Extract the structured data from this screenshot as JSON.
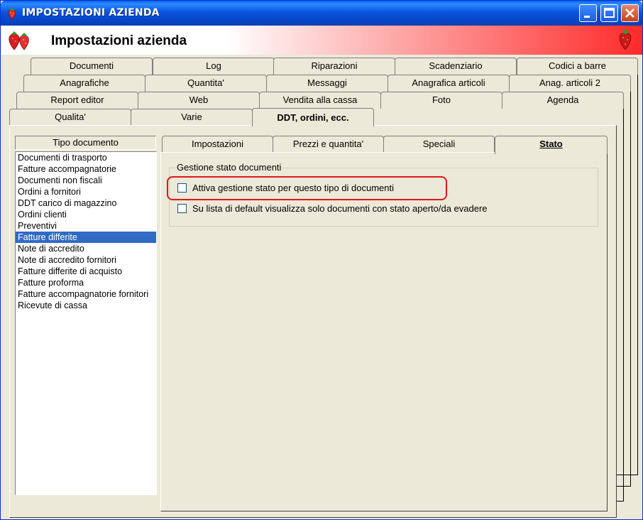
{
  "window": {
    "title": "IMPOSTAZIONI AZIENDA",
    "header_title": "Impostazioni azienda"
  },
  "tabs": {
    "row1": [
      "Documenti",
      "Log",
      "Riparazioni",
      "Scadenziario",
      "Codici a barre"
    ],
    "row2": [
      "Anagrafiche",
      "Quantita'",
      "Messaggi",
      "Anagrafica articoli",
      "Anag. articoli 2"
    ],
    "row3": [
      "Report editor",
      "Web",
      "Vendita alla cassa",
      "Foto",
      "Agenda"
    ],
    "row4": [
      "Qualita'",
      "Varie",
      "DDT, ordini, ecc."
    ],
    "active": "DDT, ordini, ecc."
  },
  "doc_types": {
    "header": "Tipo documento",
    "items": [
      "Documenti di trasporto",
      "Fatture accompagnatorie",
      "Documenti non fiscali",
      "Ordini a fornitori",
      "DDT carico di magazzino",
      "Ordini clienti",
      "Preventivi",
      "Fatture differite",
      "Note di accredito",
      "Note di accredito fornitori",
      "Fatture differite di acquisto",
      "Fatture proforma",
      "Fatture accompagnatorie fornitori",
      "Ricevute di cassa"
    ],
    "selected": "Fatture differite"
  },
  "inner_tabs": {
    "items": [
      "Impostazioni",
      "Prezzi e quantita'",
      "Speciali",
      "Stato"
    ],
    "active": "Stato"
  },
  "stato": {
    "group_label": "Gestione stato documenti",
    "option1": {
      "label": "Attiva gestione stato per questo tipo di documenti",
      "checked": false
    },
    "option2": {
      "label": "Su lista di default visualizza solo documenti con stato aperto/da evadere",
      "checked": false
    }
  },
  "colors": {
    "title_bar": "#0a55e0",
    "selection": "#316ac5",
    "highlight": "#e01818",
    "banner_gradient_end": "#ff2a2a"
  }
}
